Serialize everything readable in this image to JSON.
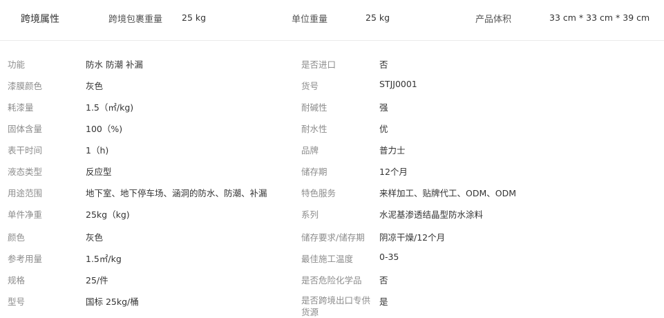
{
  "header": {
    "title": "跨境属性",
    "attrs": [
      {
        "label": "跨境包裹重量",
        "value": "25 kg"
      },
      {
        "label": "单位重量",
        "value": "25 kg"
      },
      {
        "label": "产品体积",
        "value": "33 cm * 33 cm * 39 cm"
      }
    ]
  },
  "rows": [
    {
      "left_key": "功能",
      "left_value": "防水 防潮 补漏",
      "right_key": "是否进口",
      "right_value": "否"
    },
    {
      "left_key": "漆膜颜色",
      "left_value": "灰色",
      "right_key": "货号",
      "right_value": "STJJ0001"
    },
    {
      "left_key": "耗漆量",
      "left_value": "1.5（㎡/kg)",
      "right_key": "耐碱性",
      "right_value": "强"
    },
    {
      "left_key": "固体含量",
      "left_value": "100（%)",
      "right_key": "耐水性",
      "right_value": "优"
    },
    {
      "left_key": "表干时间",
      "left_value": "1（h)",
      "right_key": "品牌",
      "right_value": "普力士"
    },
    {
      "left_key": "液态类型",
      "left_value": "反应型",
      "right_key": "储存期",
      "right_value": "12个月"
    },
    {
      "left_key": "用途范围",
      "left_value": "地下室、地下停车场、涵洞的防水、防潮、补漏",
      "right_key": "特色服务",
      "right_value": "来样加工、贴牌代工、ODM、ODM"
    },
    {
      "left_key": "单件净重",
      "left_value": "25kg（kg)",
      "right_key": "系列",
      "right_value": "水泥基渗透结晶型防水涂料"
    },
    {
      "left_key": "颜色",
      "left_value": "灰色",
      "right_key": "储存要求/储存期",
      "right_value": "阴凉干燥/12个月"
    },
    {
      "left_key": "参考用量",
      "left_value": "1.5㎡/kg",
      "right_key": "最佳施工温度",
      "right_value": "0-35"
    },
    {
      "left_key": "规格",
      "left_value": "25/件",
      "right_key": "是否危险化学品",
      "right_value": "否"
    },
    {
      "left_key": "型号",
      "left_value": "国标 25kg/桶",
      "right_key": "是否跨境出口专供货源",
      "right_value": "是"
    }
  ]
}
